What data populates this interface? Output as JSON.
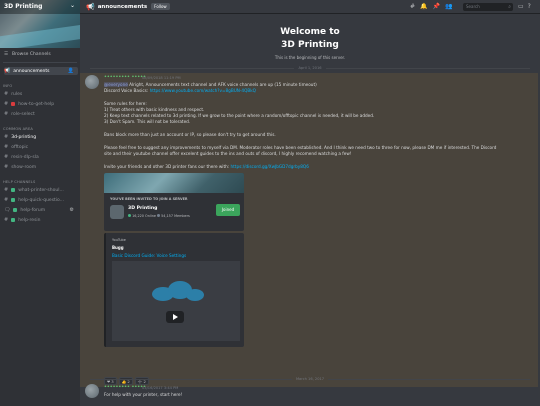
{
  "server": {
    "name": "3D Printing",
    "browse_label": "Browse Channels"
  },
  "channels": {
    "announcements": "announcements",
    "info_cat": "INFO",
    "info": [
      "rules",
      "how-to-get-help",
      "role-select"
    ],
    "common_cat": "COMMON AREA",
    "common": [
      "3d-printing",
      "offtopic",
      "resin-dlp-sla",
      "show-room"
    ],
    "help_cat": "HELP CHANNELS",
    "help": [
      "what-printer-shoul...",
      "help-quick-questio...",
      "help-forum",
      "help-resin"
    ]
  },
  "header": {
    "channel": "announcements",
    "follow": "Follow",
    "search_placeholder": "Search"
  },
  "welcome": {
    "line1": "Welcome to",
    "line2": "3D Printing",
    "sub": "This is the beginning of this server.",
    "date": "April 1, 2016"
  },
  "message": {
    "author": "••••••••• •••••",
    "timestamp": "08/09/2018 11:19 PM",
    "everyone": "@everyone",
    "line1_rest": "Alright, Announcements text channel and AFK voice channels are up (15 minute timeout)",
    "line2_label": "Discord Voice Basics:",
    "line2_link": "https://www.youtube.com/watch?v=8gBUN-4QBkQ",
    "rules_header": "Some rules for here:",
    "rule1": "1) Treat others with basic kindness and respect.",
    "rule2": "2) Keep text channels related to 3d printing. If we grow to the point where a random/offtopic channel is needed, it will be added.",
    "rule3": "3) Don't Spam. This will not be tolerated.",
    "bans": "Bans block more than just an account or IP, so please don't try to get around this.",
    "suggest1": "Please feel free to suggest any improvements to myself via DM. Moderator roles have been established. And I think we need two to three for now, please DM me if interested. The Discord",
    "suggest2": "site and their youtube channel offer excelent guides to the ins and outs of discord, I highly recomend watching a few!",
    "invite_text": "Invite your friends and other 3D printer fans our there with:",
    "invite_link": "https://discord.gg/XwJbGD7dgrby8Q6"
  },
  "invite": {
    "label": "YOU'VE BEEN INVITED TO JOIN A SERVER",
    "name": "3D Printing",
    "online": "16,220 Online",
    "members": "54,157 Members",
    "button": "Joined"
  },
  "youtube": {
    "provider": "YouTube",
    "author": "Bugg",
    "title": "Basic Discord Guide: Voice Settings"
  },
  "reactions": [
    {
      "emoji": "❤",
      "count": "3"
    },
    {
      "emoji": "👍",
      "count": "2"
    },
    {
      "emoji": "➕",
      "count": "2"
    }
  ],
  "divider2": "March 16, 2017",
  "message2": {
    "author": "••••••••• •••••",
    "timestamp": "03/16/2017 3:44 PM",
    "text": "For help with your printer, start here!"
  },
  "colors": {
    "accent_green": "#3ba55c",
    "link_blue": "#00aff4",
    "highlight": "#49443c"
  }
}
